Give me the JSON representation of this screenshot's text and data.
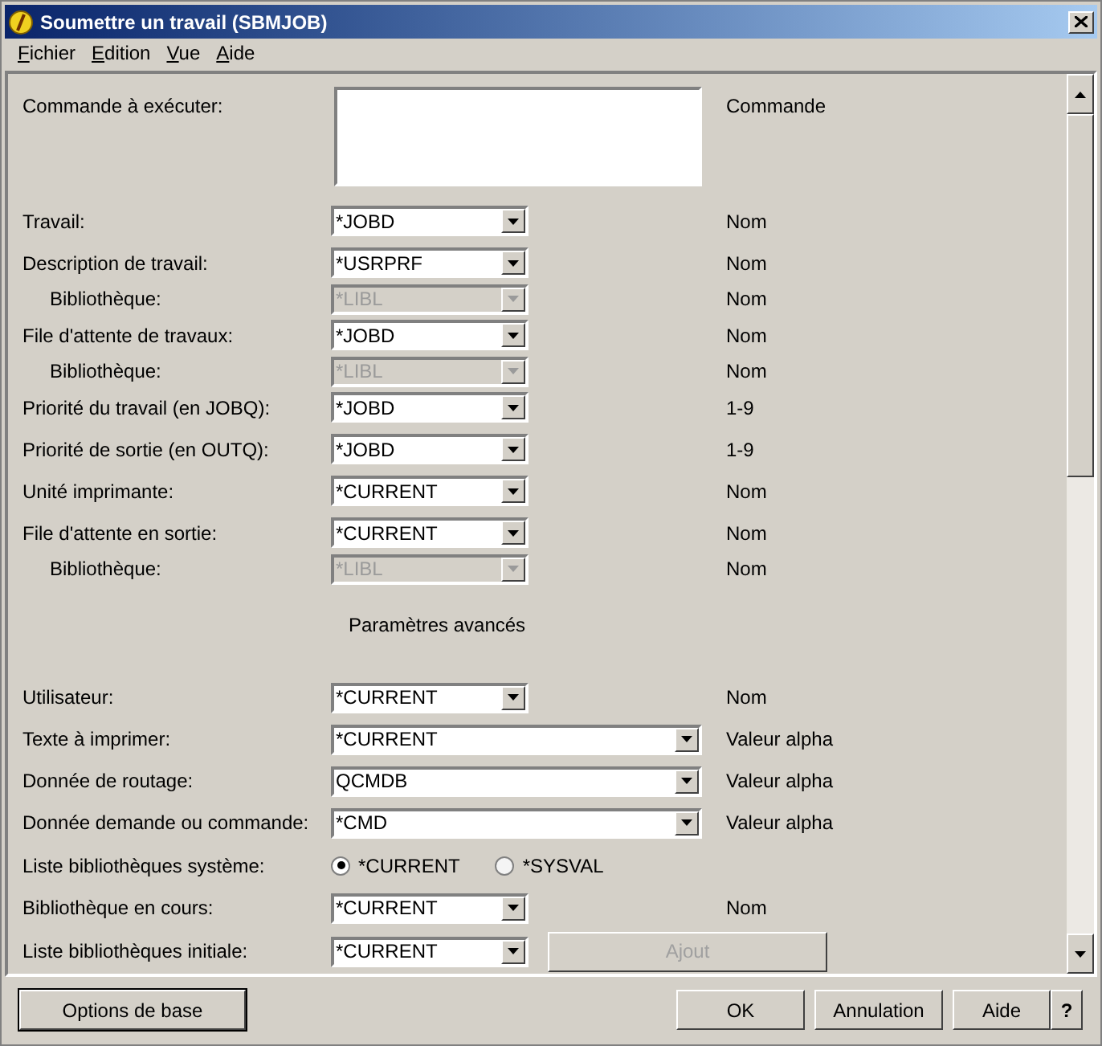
{
  "window": {
    "title": "Soumettre un travail (SBMJOB)"
  },
  "menu": [
    "Fichier",
    "Edition",
    "Vue",
    "Aide"
  ],
  "form": [
    {
      "kind": "textarea",
      "label": "Commande à exécuter:",
      "hint": "Commande"
    },
    {
      "kind": "combo",
      "label": "Travail:",
      "value": "*JOBD",
      "hint": "Nom",
      "disabled": false
    },
    {
      "kind": "combo",
      "label": "Description de travail:",
      "value": "*USRPRF",
      "hint": "Nom",
      "disabled": false
    },
    {
      "kind": "sub",
      "label": "Bibliothèque:",
      "value": "*LIBL",
      "hint": "Nom",
      "disabled": true
    },
    {
      "kind": "combo",
      "label": "File d'attente de travaux:",
      "value": "*JOBD",
      "hint": "Nom",
      "disabled": false
    },
    {
      "kind": "sub",
      "label": "Bibliothèque:",
      "value": "*LIBL",
      "hint": "Nom",
      "disabled": true
    },
    {
      "kind": "combo",
      "label": "Priorité du travail (en JOBQ):",
      "value": "*JOBD",
      "hint": "1-9",
      "disabled": false
    },
    {
      "kind": "combo",
      "label": "Priorité de sortie (en OUTQ):",
      "value": "*JOBD",
      "hint": "1-9",
      "disabled": false
    },
    {
      "kind": "combo",
      "label": "Unité imprimante:",
      "value": "*CURRENT",
      "hint": "Nom",
      "disabled": false
    },
    {
      "kind": "combo",
      "label": "File d'attente en sortie:",
      "value": "*CURRENT",
      "hint": "Nom",
      "disabled": false
    },
    {
      "kind": "sub",
      "label": "Bibliothèque:",
      "value": "*LIBL",
      "hint": "Nom",
      "disabled": true
    },
    {
      "kind": "section",
      "label": "Paramètres avancés"
    },
    {
      "kind": "combo",
      "label": "Utilisateur:",
      "value": "*CURRENT",
      "hint": "Nom",
      "disabled": false
    },
    {
      "kind": "wide",
      "label": "Texte à imprimer:",
      "value": "*CURRENT",
      "hint": "Valeur alpha",
      "disabled": false
    },
    {
      "kind": "wide",
      "label": "Donnée de routage:",
      "value": "QCMDB",
      "hint": "Valeur alpha",
      "disabled": false
    },
    {
      "kind": "wide",
      "label": "Donnée demande ou commande:",
      "value": "*CMD",
      "hint": "Valeur alpha",
      "disabled": false
    },
    {
      "kind": "radio",
      "label": "Liste bibliothèques système:",
      "options": [
        {
          "label": "*CURRENT",
          "selected": true
        },
        {
          "label": "*SYSVAL",
          "selected": false
        }
      ]
    },
    {
      "kind": "combo",
      "label": "Bibliothèque en cours:",
      "value": "*CURRENT",
      "hint": "Nom",
      "disabled": false
    },
    {
      "kind": "combo-button",
      "label": "Liste bibliothèques initiale:",
      "value": "*CURRENT",
      "disabled": false,
      "button": {
        "label": "Ajout",
        "disabled": true
      }
    }
  ],
  "buttons": {
    "left": {
      "label": "Options de base"
    },
    "right": [
      {
        "label": "OK"
      },
      {
        "label": "Annulation"
      },
      {
        "label": "Aide"
      }
    ],
    "help": "?"
  }
}
